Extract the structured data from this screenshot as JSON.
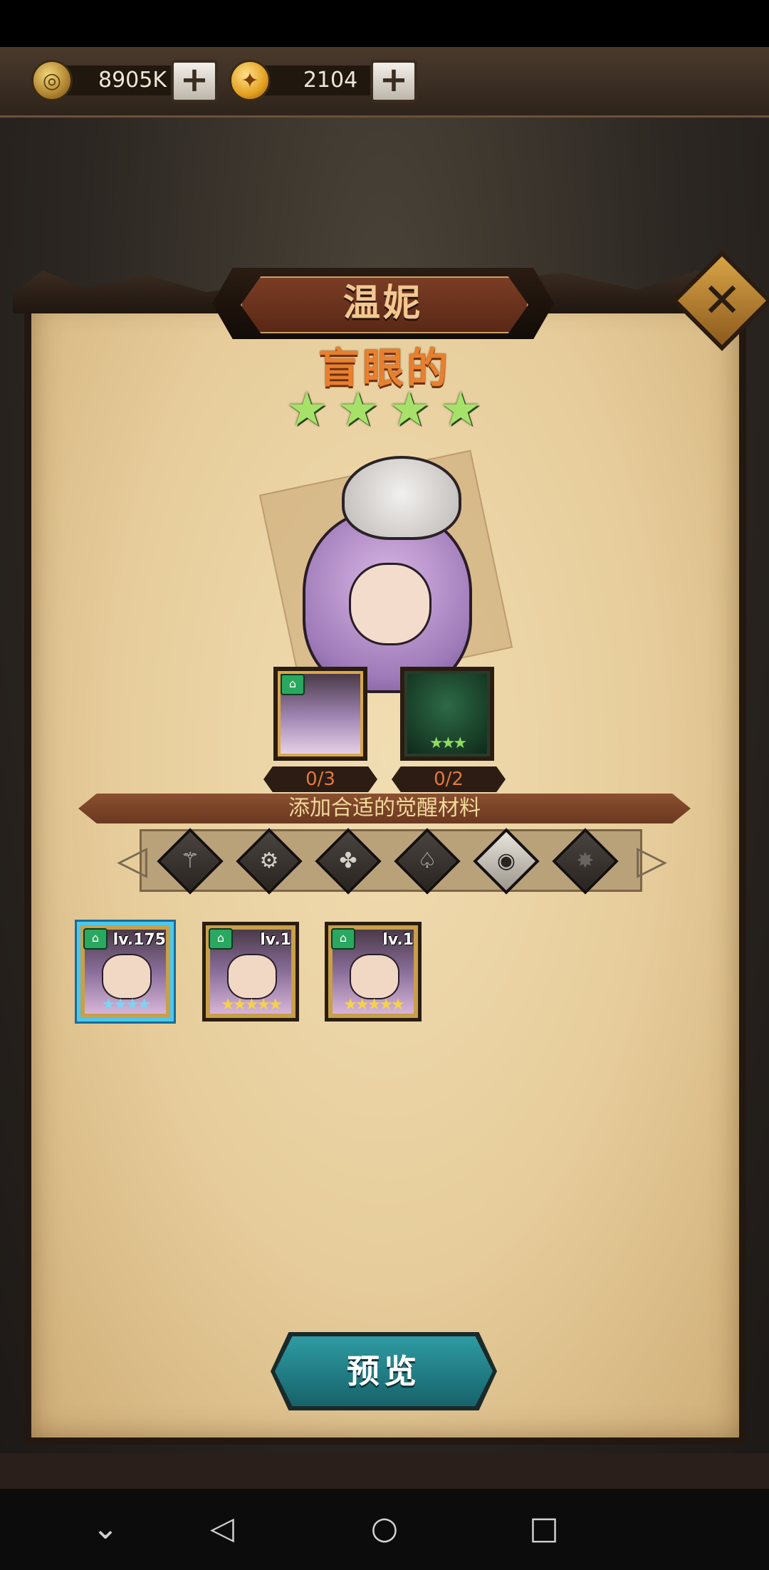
{
  "resources": [
    {
      "icon": "medal-coin-icon",
      "value": "8905K"
    },
    {
      "icon": "gold-coin-icon",
      "value": "2104"
    }
  ],
  "add_label": "+",
  "dialog": {
    "title": "温妮",
    "subtitle": "盲眼的",
    "star_count": 4,
    "close_label": "✕"
  },
  "materials": [
    {
      "label": "0/3",
      "type": "hero-portrait"
    },
    {
      "label": "0/2",
      "type": "green-hood-portrait",
      "stars": "★★★"
    }
  ],
  "banner_text": "添加合适的觉醒材料",
  "filters": [
    "faction-1-icon",
    "faction-2-icon",
    "faction-3-icon",
    "faction-4-icon",
    "faction-5-icon",
    "faction-6-icon"
  ],
  "heroes": [
    {
      "level": "lv.175",
      "stars": "★★★★",
      "selected": true
    },
    {
      "level": "lv.1",
      "stars": "★★★★★",
      "selected": false
    },
    {
      "level": "lv.1",
      "stars": "★★★★★",
      "selected": false
    }
  ],
  "preview_label": "预览",
  "nav": {
    "down": "⌄",
    "back": "◁",
    "home": "○",
    "recent": "□"
  }
}
